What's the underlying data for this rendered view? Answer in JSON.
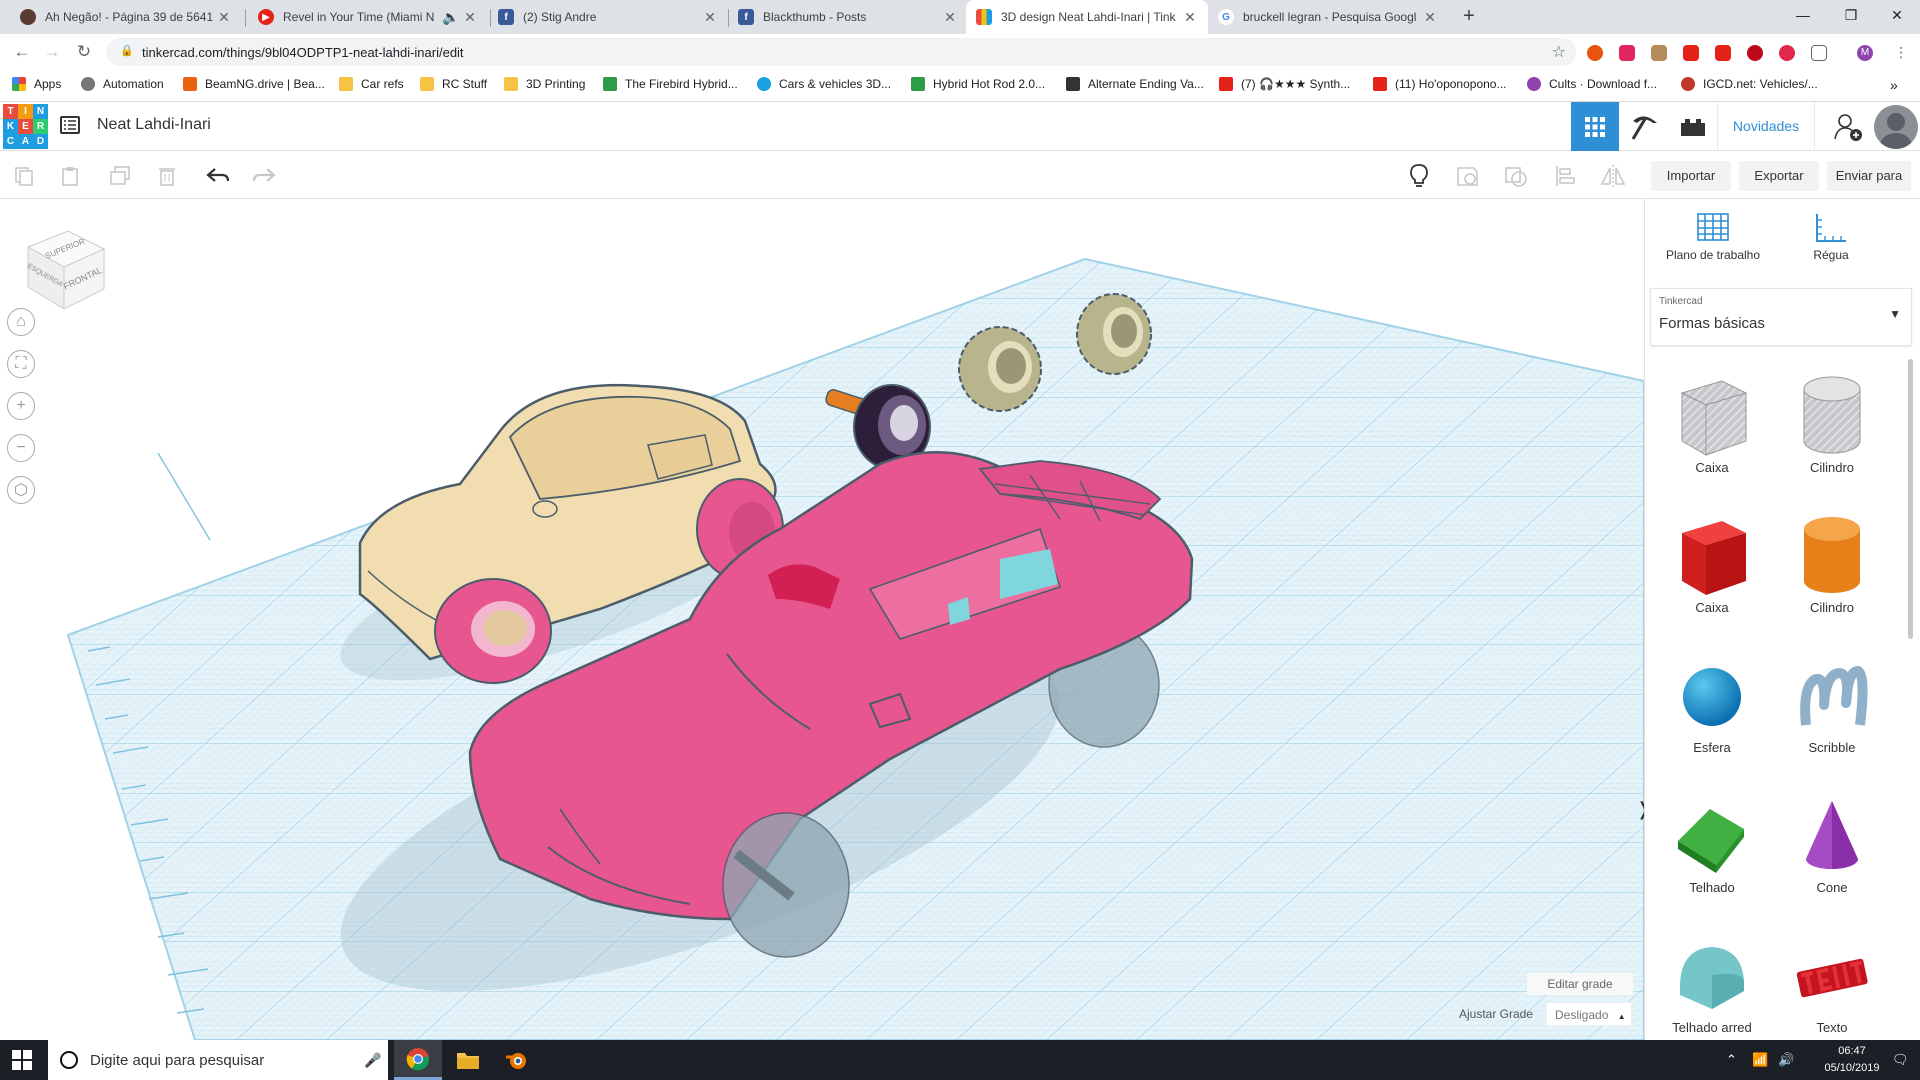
{
  "browser": {
    "tabs": [
      {
        "title": "Ah Negão! - Página 39 de 5641",
        "icon": "site-icon",
        "color": "#5a3b32",
        "active": false
      },
      {
        "title": "Revel in Your Time (Miami N",
        "icon": "youtube-icon",
        "color": "#e62117",
        "active": false
      },
      {
        "title": "(2) Stig Andre",
        "icon": "facebook-icon",
        "color": "#3b5998",
        "active": false
      },
      {
        "title": "Blackthumb - Posts",
        "icon": "facebook-icon",
        "color": "#3b5998",
        "active": false
      },
      {
        "title": "3D design Neat Lahdi-Inari | Tink",
        "icon": "tinkercad-icon",
        "color": "#1e9ee0",
        "active": true
      },
      {
        "title": "bruckell legran - Pesquisa Googl",
        "icon": "google-icon",
        "color": "#4285f4",
        "active": false
      }
    ],
    "url": "tinkercad.com/things/9bl04ODPTP1-neat-lahdi-inari/edit",
    "bookmarks": [
      {
        "label": "Apps",
        "color": "#e94235"
      },
      {
        "label": "Automation",
        "color": "#777777"
      },
      {
        "label": "BeamNG.drive | Bea...",
        "color": "#e8620e"
      },
      {
        "label": "Car refs",
        "color": "#f6c344"
      },
      {
        "label": "RC Stuff",
        "color": "#f6c344"
      },
      {
        "label": "3D Printing",
        "color": "#f6c344"
      },
      {
        "label": "The Firebird Hybrid...",
        "color": "#2e9c46"
      },
      {
        "label": "Cars & vehicles 3D...",
        "color": "#1ba1e2"
      },
      {
        "label": "Hybrid Hot Rod 2.0...",
        "color": "#2e9c46"
      },
      {
        "label": "Alternate Ending Va...",
        "color": "#333333"
      },
      {
        "label": "(7) 🎧★★★ Synth...",
        "color": "#e62117"
      },
      {
        "label": "(11) Ho'oponopono...",
        "color": "#e62117"
      },
      {
        "label": "Cults · Download f...",
        "color": "#8e44ad"
      },
      {
        "label": "IGCD.net: Vehicles/...",
        "color": "#c0392b"
      }
    ]
  },
  "app": {
    "logo_letters": [
      "T",
      "I",
      "N",
      "K",
      "E",
      "R",
      "C",
      "A",
      "D"
    ],
    "design_title": "Neat Lahdi-Inari",
    "novidades": "Novidades",
    "import_label": "Importar",
    "export_label": "Exportar",
    "send_label": "Enviar para"
  },
  "viewcube": {
    "top": "SUPERIOR",
    "front": "FRONTAL",
    "side": "ESQUERDA"
  },
  "panel": {
    "workplane_label": "Plano de trabalho",
    "ruler_label": "Régua",
    "category_caption": "Tinkercad",
    "category_value": "Formas básicas",
    "shapes": [
      {
        "label": "Caixa",
        "icon": "box-hole-icon"
      },
      {
        "label": "Cilindro",
        "icon": "cylinder-hole-icon"
      },
      {
        "label": "Caixa",
        "icon": "box-icon"
      },
      {
        "label": "Cilindro",
        "icon": "cylinder-icon"
      },
      {
        "label": "Esfera",
        "icon": "sphere-icon"
      },
      {
        "label": "Scribble",
        "icon": "scribble-icon"
      },
      {
        "label": "Telhado",
        "icon": "roof-icon"
      },
      {
        "label": "Cone",
        "icon": "cone-icon"
      },
      {
        "label": "Telhado arred",
        "icon": "round-roof-icon"
      },
      {
        "label": "Texto",
        "icon": "text-icon"
      }
    ]
  },
  "grid": {
    "edit_label": "Editar grade",
    "snap_label": "Ajustar Grade",
    "snap_value": "Desligado"
  },
  "taskbar": {
    "search_placeholder": "Digite aqui para pesquisar",
    "time": "06:47",
    "date": "05/10/2019"
  },
  "colors": {
    "accent": "#2e8ed6",
    "grid": "#c8e6f3",
    "pink_car": "#e8568f",
    "beige_car": "#f1ddb0"
  }
}
